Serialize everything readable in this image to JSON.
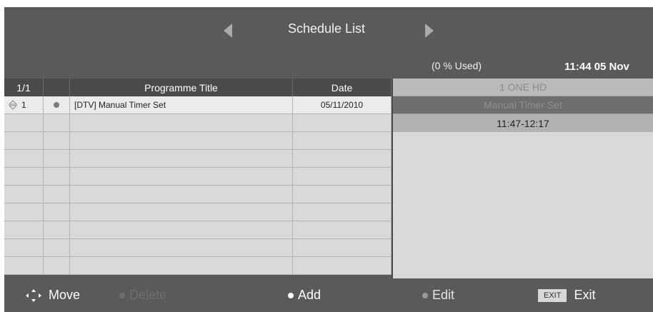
{
  "header": {
    "title": "Schedule List",
    "usage": "(0 % Used)",
    "clock": "11:44 05 Nov"
  },
  "table": {
    "columns": [
      "1/1",
      "",
      "Programme Title",
      "Date"
    ],
    "rows": [
      {
        "index": "1",
        "title": "[DTV] Manual Timer Set",
        "date": "05/11/2010"
      }
    ]
  },
  "detail": {
    "channel": "1 ONE HD",
    "name": "Manual Timer Set",
    "time": "11:47-12:17"
  },
  "footer": {
    "move": "Move",
    "delete": "Delete",
    "add": "Add",
    "edit": "Edit",
    "exit_key": "EXIT",
    "exit": "Exit"
  },
  "colors": {
    "background": "#5a5a5a",
    "row": "#d9d9d9",
    "selected_row": "#ebebeb",
    "disabled_text": "#6e6e6e"
  }
}
